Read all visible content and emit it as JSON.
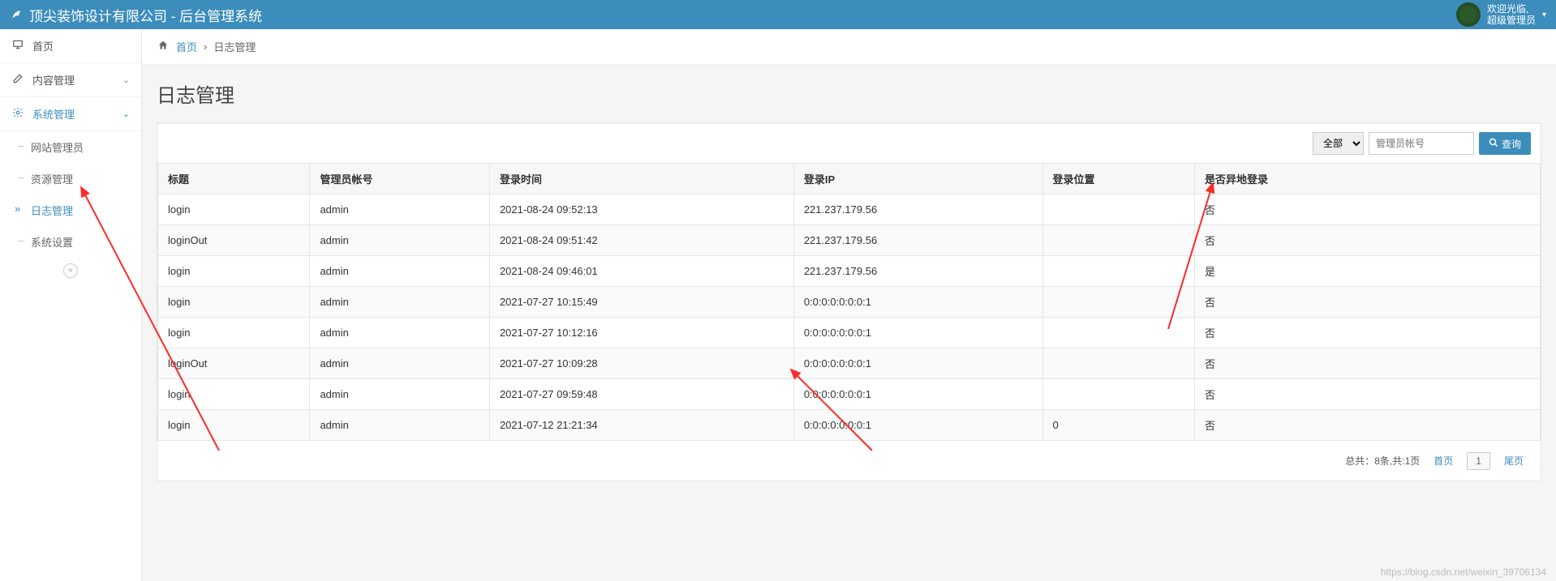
{
  "header": {
    "brand": "顶尖装饰设计有限公司 - 后台管理系统",
    "welcome_line1": "欢迎光临,",
    "welcome_line2": "超级管理员"
  },
  "sidebar": {
    "home": "首页",
    "content": "内容管理",
    "system": "系统管理",
    "subs": {
      "admins": "网站管理员",
      "resources": "资源管理",
      "logs": "日志管理",
      "settings": "系统设置"
    }
  },
  "breadcrumb": {
    "home": "首页",
    "current": "日志管理"
  },
  "page": {
    "title": "日志管理"
  },
  "filter": {
    "select_all": "全部",
    "placeholder": "管理员帐号",
    "search_label": "查询"
  },
  "table": {
    "headers": {
      "title": "标题",
      "account": "管理员帐号",
      "login_time": "登录时间",
      "login_ip": "登录IP",
      "login_location": "登录位置",
      "remote_login": "是否异地登录"
    },
    "rows": [
      {
        "title": "login",
        "account": "admin",
        "login_time": "2021-08-24 09:52:13",
        "login_ip": "221.237.179.56",
        "login_location": "",
        "remote_login": "否"
      },
      {
        "title": "loginOut",
        "account": "admin",
        "login_time": "2021-08-24 09:51:42",
        "login_ip": "221.237.179.56",
        "login_location": "",
        "remote_login": "否"
      },
      {
        "title": "login",
        "account": "admin",
        "login_time": "2021-08-24 09:46:01",
        "login_ip": "221.237.179.56",
        "login_location": "",
        "remote_login": "是"
      },
      {
        "title": "login",
        "account": "admin",
        "login_time": "2021-07-27 10:15:49",
        "login_ip": "0:0:0:0:0:0:0:1",
        "login_location": "",
        "remote_login": "否"
      },
      {
        "title": "login",
        "account": "admin",
        "login_time": "2021-07-27 10:12:16",
        "login_ip": "0:0:0:0:0:0:0:1",
        "login_location": "",
        "remote_login": "否"
      },
      {
        "title": "loginOut",
        "account": "admin",
        "login_time": "2021-07-27 10:09:28",
        "login_ip": "0:0:0:0:0:0:0:1",
        "login_location": "",
        "remote_login": "否"
      },
      {
        "title": "login",
        "account": "admin",
        "login_time": "2021-07-27 09:59:48",
        "login_ip": "0:0:0:0:0:0:0:1",
        "login_location": "",
        "remote_login": "否"
      },
      {
        "title": "login",
        "account": "admin",
        "login_time": "2021-07-12 21:21:34",
        "login_ip": "0:0:0:0:0:0:0:1",
        "login_location": "0",
        "remote_login": "否"
      }
    ]
  },
  "pager": {
    "summary": "总共：8条,共:1页",
    "first": "首页",
    "page": "1",
    "last": "尾页"
  },
  "watermark": "https://blog.csdn.net/weixin_39706134"
}
